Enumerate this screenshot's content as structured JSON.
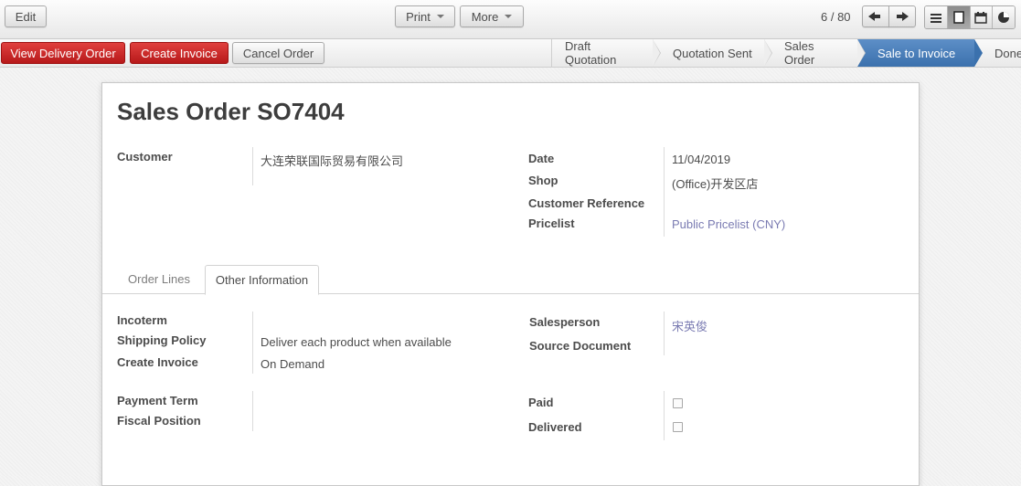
{
  "toolbar": {
    "edit_label": "Edit",
    "print_label": "Print",
    "more_label": "More",
    "pager_text": "6 / 80"
  },
  "actions": {
    "view_delivery_label": "View Delivery Order",
    "create_invoice_label": "Create Invoice",
    "cancel_order_label": "Cancel Order"
  },
  "statusbar": {
    "stages": [
      "Draft Quotation",
      "Quotation Sent",
      "Sales Order",
      "Sale to Invoice",
      "Done"
    ],
    "active_stage": "Sale to Invoice"
  },
  "form": {
    "title_prefix": "Sales Order",
    "order_number": "SO7404",
    "customer_label": "Customer",
    "customer_value": "大连荣联国际贸易有限公司",
    "date_label": "Date",
    "date_value": "11/04/2019",
    "shop_label": "Shop",
    "shop_value": "(Office)开发区店",
    "customer_reference_label": "Customer Reference",
    "customer_reference_value": "",
    "pricelist_label": "Pricelist",
    "pricelist_value": "Public Pricelist (CNY)"
  },
  "tabs": {
    "order_lines_label": "Order Lines",
    "other_info_label": "Other Information",
    "active": "Other Information"
  },
  "other_info": {
    "incoterm_label": "Incoterm",
    "incoterm_value": "",
    "shipping_policy_label": "Shipping Policy",
    "shipping_policy_value": "Deliver each product when available",
    "create_invoice_label": "Create Invoice",
    "create_invoice_value": "On Demand",
    "salesperson_label": "Salesperson",
    "salesperson_value": "宋英俊",
    "source_document_label": "Source Document",
    "source_document_value": "",
    "payment_term_label": "Payment Term",
    "payment_term_value": "",
    "fiscal_position_label": "Fiscal Position",
    "fiscal_position_value": "",
    "paid_label": "Paid",
    "paid_checked": false,
    "delivered_label": "Delivered",
    "delivered_checked": false
  },
  "colors": {
    "primary_red": "#c9302c",
    "active_stage_blue": "#3b71ad",
    "link": "#7a7bb2"
  }
}
